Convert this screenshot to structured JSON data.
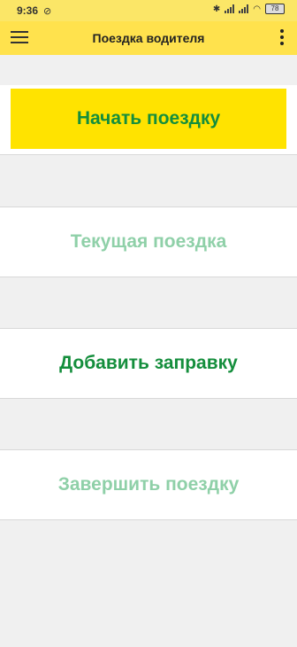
{
  "status_bar": {
    "time": "9:36",
    "mute_icon": "alarm-off-icon",
    "battery": "78"
  },
  "app_bar": {
    "title": "Поездка водителя",
    "menu_icon": "hamburger-menu-icon",
    "more_icon": "more-vert-icon"
  },
  "actions": {
    "start_trip": "Начать поездку",
    "current_trip": "Текущая поездка",
    "add_refuel": "Добавить заправку",
    "finish_trip": "Завершить поездку"
  },
  "colors": {
    "app_bar": "#ffe24d",
    "primary_button": "#ffe300",
    "green_active": "#148e3c",
    "green_disabled": "#8fd0a8",
    "background": "#f0f0f0"
  }
}
